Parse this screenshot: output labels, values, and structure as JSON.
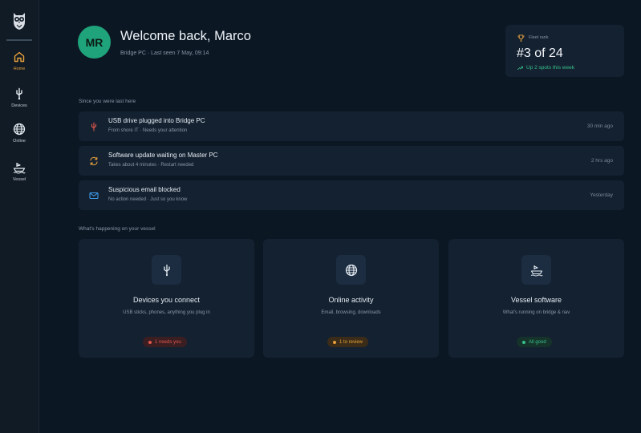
{
  "sidebar": {
    "items": [
      {
        "label": "Home",
        "icon": "home-icon",
        "active": true
      },
      {
        "label": "Devices",
        "icon": "usb-icon",
        "active": false
      },
      {
        "label": "Online",
        "icon": "globe-icon",
        "active": false
      },
      {
        "label": "Vessel",
        "icon": "ship-icon",
        "active": false
      }
    ]
  },
  "user": {
    "initials": "MR",
    "greeting": "Welcome back, Marco",
    "subline": "Bridge PC · Last seen 7 May, 09:14"
  },
  "rank": {
    "label": "Fleet rank",
    "value": "#3 of 24",
    "delta": "Up 2 spots this week"
  },
  "recent": {
    "heading": "Since you were last here",
    "events": [
      {
        "title": "USB drive plugged into Bridge PC",
        "subtitle": "From shore IT · Needs your attention",
        "time": "30 min ago",
        "icon": "usb-icon",
        "color": "#e2574c"
      },
      {
        "title": "Software update waiting on Master PC",
        "subtitle": "Takes about 4 minutes · Restart needed",
        "time": "2 hrs ago",
        "icon": "refresh-icon",
        "color": "#e7a13b"
      },
      {
        "title": "Suspicious email blocked",
        "subtitle": "No action needed · Just so you know",
        "time": "Yesterday",
        "icon": "mail-icon",
        "color": "#3d9be9"
      }
    ]
  },
  "vessel": {
    "heading": "What's happening on your vessel",
    "cards": [
      {
        "title": "Devices you connect",
        "subtitle": "USB sticks, phones, anything you plug in",
        "badge": "1 needs you",
        "status": "alert",
        "icon": "usb-icon"
      },
      {
        "title": "Online activity",
        "subtitle": "Email, browsing, downloads",
        "badge": "1 to review",
        "status": "warning",
        "icon": "globe-icon"
      },
      {
        "title": "Vessel software",
        "subtitle": "What's running on bridge & nav",
        "badge": "All good",
        "status": "ok",
        "icon": "ship-icon"
      }
    ]
  },
  "colors": {
    "accent": "#e7a13b",
    "avatar": "#1fa37a",
    "positive": "#38c08a",
    "alert": "#e2574c",
    "warning": "#e7a13b",
    "ok": "#38c08a"
  }
}
